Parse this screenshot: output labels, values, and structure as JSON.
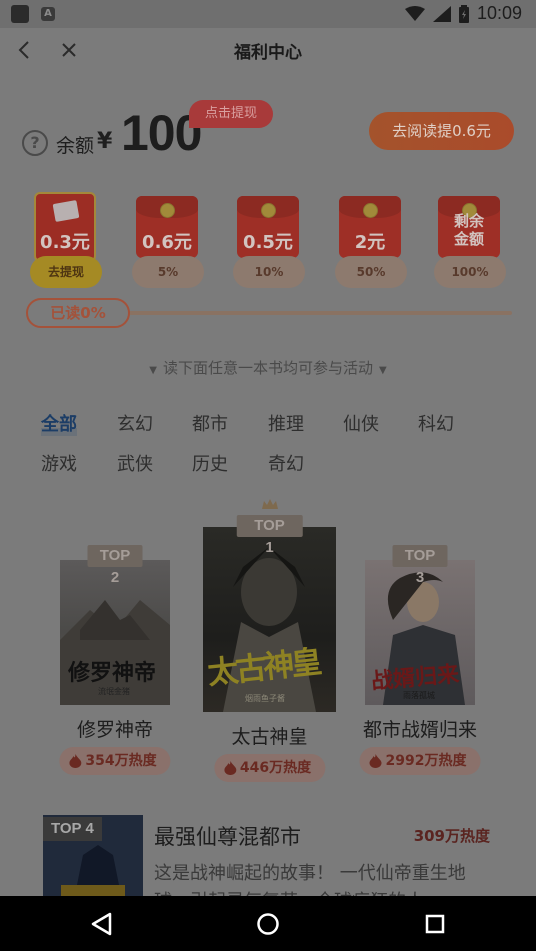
{
  "status_bar": {
    "time": "10:09",
    "icon_a": "A"
  },
  "nav": {
    "title": "福利中心"
  },
  "balance": {
    "label": "余额",
    "currency": "¥",
    "amount": "100",
    "withdraw_tag": "点击提现",
    "read_withdraw": "去阅读提0.6元"
  },
  "envelopes": [
    {
      "amount": "0.3元",
      "caption": "去提现"
    },
    {
      "amount": "0.6元",
      "caption": "5%"
    },
    {
      "amount": "0.5元",
      "caption": "10%"
    },
    {
      "amount": "2元",
      "caption": "50%"
    },
    {
      "amount_line1": "剩余",
      "amount_line2": "金额",
      "caption": "100%"
    }
  ],
  "progress": {
    "label": "已读0%",
    "value": 0
  },
  "hint": "读下面任意一本书均可参与活动",
  "categories": [
    "全部",
    "玄幻",
    "都市",
    "推理",
    "仙侠",
    "科幻",
    "游戏",
    "武侠",
    "历史",
    "奇幻"
  ],
  "active_category": "全部",
  "top_books": [
    {
      "rank": "TOP 2",
      "title": "修罗神帝",
      "heat": "354万热度",
      "cover_text": "修罗神帝",
      "cover_author": "流氓金猪"
    },
    {
      "rank": "TOP 1",
      "title": "太古神皇",
      "heat": "446万热度",
      "cover_text": "太古神皇",
      "cover_author": "烟雨鱼子酱"
    },
    {
      "rank": "TOP 3",
      "title": "都市战婿归来",
      "heat": "2992万热度",
      "cover_text": "战婿归来",
      "cover_author": "雨落孤城"
    }
  ],
  "list_book": {
    "rank": "TOP 4",
    "title": "最强仙尊混都市",
    "heat": "309万热度",
    "desc": "这是战神崛起的故事！ 一代仙帝重生地球，引起灵气复苏，全球疯狂的人"
  },
  "colors": {
    "overlay_bg": "#7b7b7b",
    "accent_red": "#9e2f26",
    "accent_orange": "#a4532c"
  }
}
